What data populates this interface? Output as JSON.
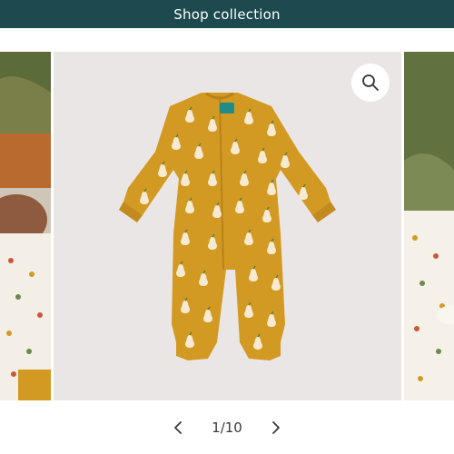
{
  "header": {
    "shop_label": "Shop collection"
  },
  "gallery": {
    "current_index": "1",
    "total": "10",
    "separator": "/",
    "zoom_icon": "search-icon",
    "prev_icon": "chevron-left-icon",
    "next_icon": "chevron-right-icon"
  },
  "colors": {
    "header_bg": "#1d4a4e",
    "product": "#d39a23",
    "pear": "#f6ead2",
    "leaf": "#5a7a3a",
    "main_bg": "#ebe6e6"
  }
}
